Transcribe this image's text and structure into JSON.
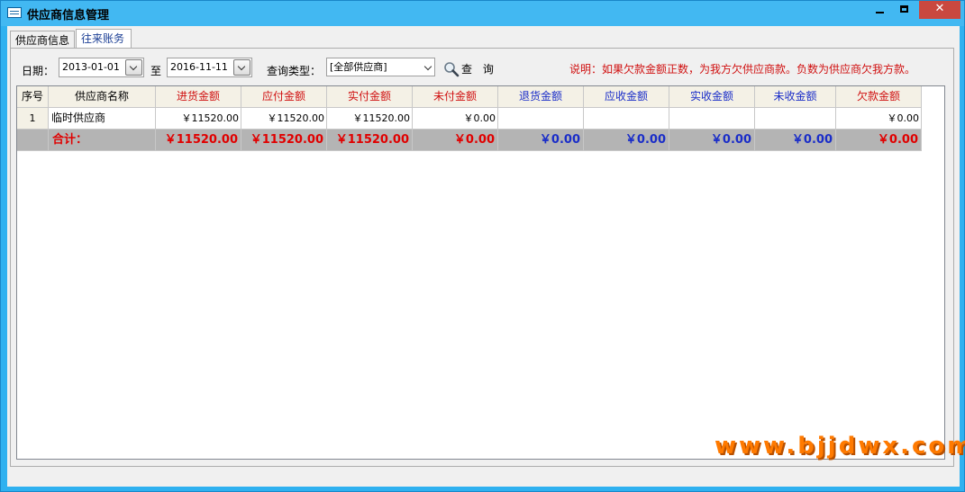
{
  "window": {
    "title": "供应商信息管理",
    "close_glyph": "✕"
  },
  "tabs": [
    {
      "label": "供应商信息"
    },
    {
      "label": "往来账务"
    }
  ],
  "filters": {
    "date_label": "日期：",
    "start_date": "2013-01-01",
    "to_label": "至",
    "end_date": "2016-11-11",
    "query_type_label": "查询类型：",
    "query_type_value": "[全部供应商]",
    "query_button": "查 询"
  },
  "note": "说明：如果欠款金额正数，为我方欠供应商款。负数为供应商欠我方款。",
  "table": {
    "columns": [
      "序号",
      "供应商名称",
      "进货金额",
      "应付金额",
      "实付金额",
      "未付金额",
      "退货金额",
      "应收金额",
      "实收金额",
      "未收金额",
      "欠款金额"
    ],
    "rows": [
      [
        "1",
        "临时供应商",
        "￥11520.00",
        "￥11520.00",
        "￥11520.00",
        "￥0.00",
        "",
        "",
        "",
        "",
        "￥0.00"
      ]
    ],
    "total": [
      "",
      "合计：",
      "￥11520.00",
      "￥11520.00",
      "￥11520.00",
      "￥0.00",
      "￥0.00",
      "￥0.00",
      "￥0.00",
      "￥0.00",
      "￥0.00"
    ]
  },
  "colors": {
    "header_red": "#d01010",
    "header_blue": "#1a2dc8",
    "total_bg": "#b4b4b4",
    "title_bar": "#42b8f2"
  },
  "watermark": "www.bjjdwx.com"
}
